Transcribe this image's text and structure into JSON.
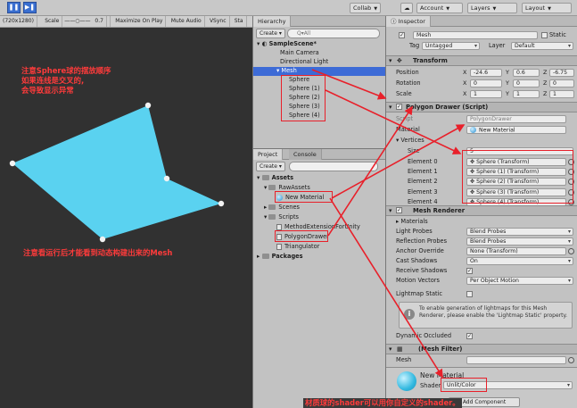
{
  "toolbar": {
    "play_icon": "pause-icon",
    "step_icon": "step-icon",
    "collab": "Collab",
    "account": "Account",
    "layers": "Layers",
    "layout": "Layout"
  },
  "game": {
    "resolution": "(720x1280)",
    "scale_label": "Scale",
    "scale_value": "0.7",
    "maximize": "Maximize On Play",
    "mute": "Mute Audio",
    "vsync": "VSync",
    "stats": "Sta",
    "polygon_color": "#5ad2f0"
  },
  "annotations": {
    "top_line1": "注意Sphere球的摆放顺序",
    "top_line2": "如果连线是交叉的,",
    "top_line3": "会导致显示异常",
    "bottom": "注意看运行后才能看到动态构建出来的Mesh",
    "shader_note": "材质球的shader可以用你自定义的shader。",
    "color": "#ff3b3b"
  },
  "hierarchy": {
    "tab": "Hierarchy",
    "create": "Create",
    "search_placeholder": "Q▾All",
    "scene": "SampleScene*",
    "items": [
      "Main Camera",
      "Directional Light",
      "Mesh",
      "Sphere",
      "Sphere (1)",
      "Sphere (2)",
      "Sphere (3)",
      "Sphere (4)"
    ]
  },
  "project": {
    "tab_project": "Project",
    "tab_console": "Console",
    "create": "Create",
    "assets": "Assets",
    "raw_assets": "RawAssets",
    "new_material": "New Material",
    "scenes": "Scenes",
    "scripts": "Scripts",
    "method_ext": "MethodExtensionForUnity",
    "polygon_drawer": "PolygonDrawer",
    "triangulator": "Triangulator",
    "packages": "Packages"
  },
  "inspector": {
    "tab": "Inspector",
    "object_name": "Mesh",
    "static_label": "Static",
    "tag_label": "Tag",
    "tag_value": "Untagged",
    "layer_label": "Layer",
    "layer_value": "Default",
    "transform": {
      "title": "Transform",
      "position_label": "Position",
      "rotation_label": "Rotation",
      "scale_label": "Scale",
      "position": [
        "-24.6",
        "0.6",
        "-6.75"
      ],
      "rotation": [
        "0",
        "0",
        "0"
      ],
      "scale": [
        "1",
        "1",
        "1"
      ]
    },
    "polygon": {
      "title": "Polygon Drawer (Script)",
      "script_label": "Script",
      "script_value": "PolygonDrawer",
      "material_label": "Material",
      "material_value": "New Material",
      "vertices_label": "Vertices",
      "size_label": "Size",
      "size_value": "5",
      "elements": [
        {
          "label": "Element 0",
          "value": "Sphere (Transform)"
        },
        {
          "label": "Element 1",
          "value": "Sphere (1) (Transform)"
        },
        {
          "label": "Element 2",
          "value": "Sphere (2) (Transform)"
        },
        {
          "label": "Element 3",
          "value": "Sphere (3) (Transform)"
        },
        {
          "label": "Element 4",
          "value": "Sphere (4) (Transform)"
        }
      ]
    },
    "renderer": {
      "title": "Mesh Renderer",
      "materials_label": "Materials",
      "light_probes_label": "Light Probes",
      "light_probes_value": "Blend Probes",
      "reflection_label": "Reflection Probes",
      "reflection_value": "Blend Probes",
      "anchor_label": "Anchor Override",
      "anchor_value": "None (Transform)",
      "cast_label": "Cast Shadows",
      "cast_value": "On",
      "receive_label": "Receive Shadows",
      "motion_label": "Motion Vectors",
      "motion_value": "Per Object Motion",
      "lightmap_label": "Lightmap Static",
      "help_text": "To enable generation of lightmaps for this Mesh Renderer, please enable the 'Lightmap Static' property.",
      "dynamic_label": "Dynamic Occluded"
    },
    "mesh_filter": {
      "title": "(Mesh Filter)",
      "mesh_label": "Mesh"
    },
    "material": {
      "name": "New Material",
      "shader_label": "Shader",
      "shader_value": "Unlit/Color",
      "add_component": "Add Component"
    }
  }
}
